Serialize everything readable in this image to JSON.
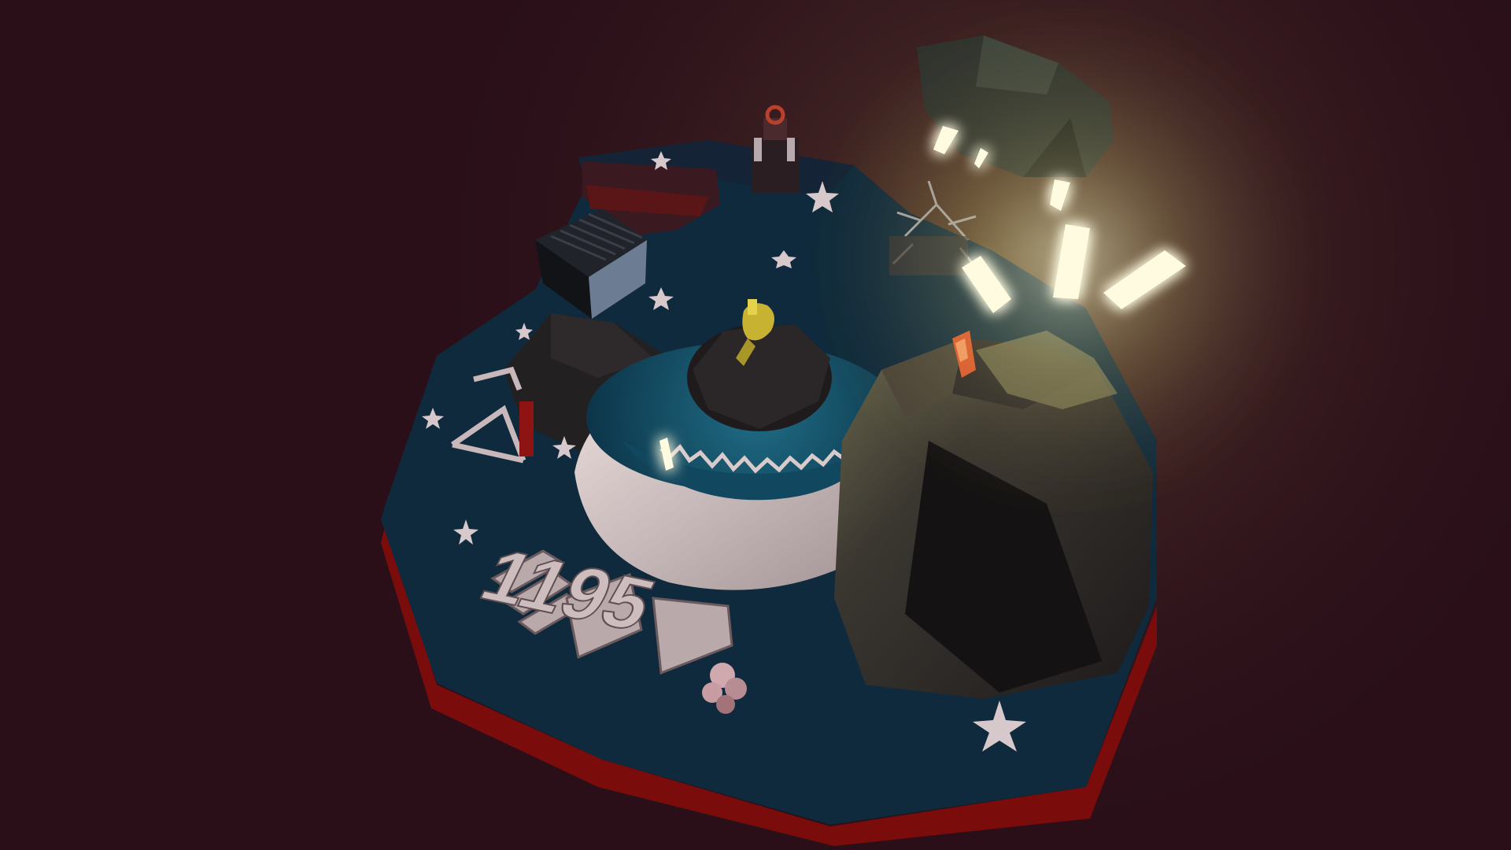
{
  "scene": {
    "kind": "low-poly 3D diorama render",
    "background_color": "#2a0f19",
    "platform_color": "#0f2a3c",
    "platform_rim_color": "#7a0c0c",
    "glow_color": "#fff6c0",
    "snow_color": "#e6d6d6",
    "rock_color": "#262222",
    "engraved_text": "1195"
  }
}
